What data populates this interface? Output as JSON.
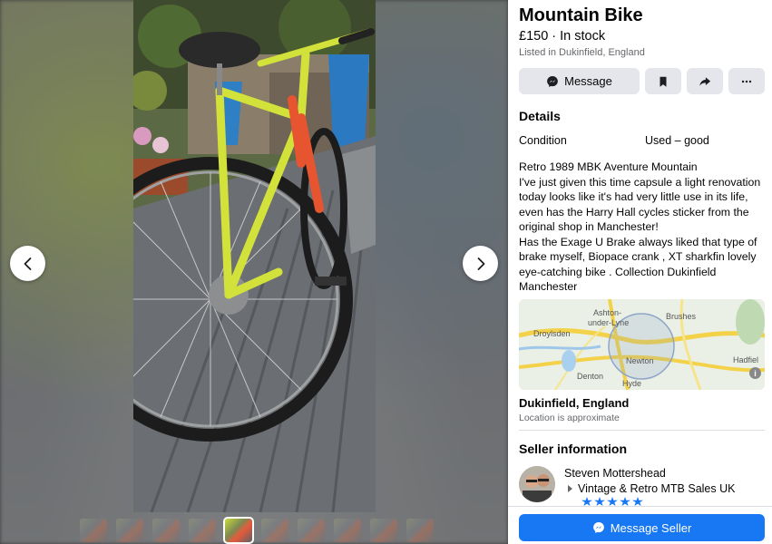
{
  "listing": {
    "title": "Mountain Bike",
    "price_status": "£150 · In stock",
    "listed_in": "Listed in Dukinfield, England"
  },
  "actions": {
    "message_label": "Message"
  },
  "details": {
    "heading": "Details",
    "condition_label": "Condition",
    "condition_value": "Used – good",
    "description_lines": [
      "Retro 1989 MBK Aventure Mountain",
      "I've just given this time capsule a light renovation",
      "today looks like it's had very little use in its life,",
      "even has the Harry Hall cycles sticker from the",
      "original shop in Manchester!",
      "Has the Exage U Brake always liked that type of",
      "brake myself,  Biopace crank ,  XT sharkfin lovely",
      "eye-catching bike . Collection Dukinfield",
      "Manchester"
    ]
  },
  "map": {
    "labels": [
      "Ashton-",
      "under-Lyne",
      "Brushes",
      "Droylsden",
      "Newton",
      "Denton",
      "Hyde",
      "Hadfiel"
    ]
  },
  "location": {
    "name": "Dukinfield, England",
    "note": "Location is approximate"
  },
  "seller": {
    "heading": "Seller information",
    "name": "Steven Mottershead",
    "group": "Vintage & Retro MTB Sales UK"
  },
  "footer": {
    "message_seller_label": "Message Seller"
  },
  "colors": {
    "accent": "#1877f2",
    "button_gray": "#e4e6eb"
  },
  "icons": {
    "message": "messenger-icon",
    "save": "bookmark-icon",
    "share": "share-arrow-icon",
    "more": "more-dots-icon",
    "prev": "chevron-left-icon",
    "next": "chevron-right-icon"
  }
}
